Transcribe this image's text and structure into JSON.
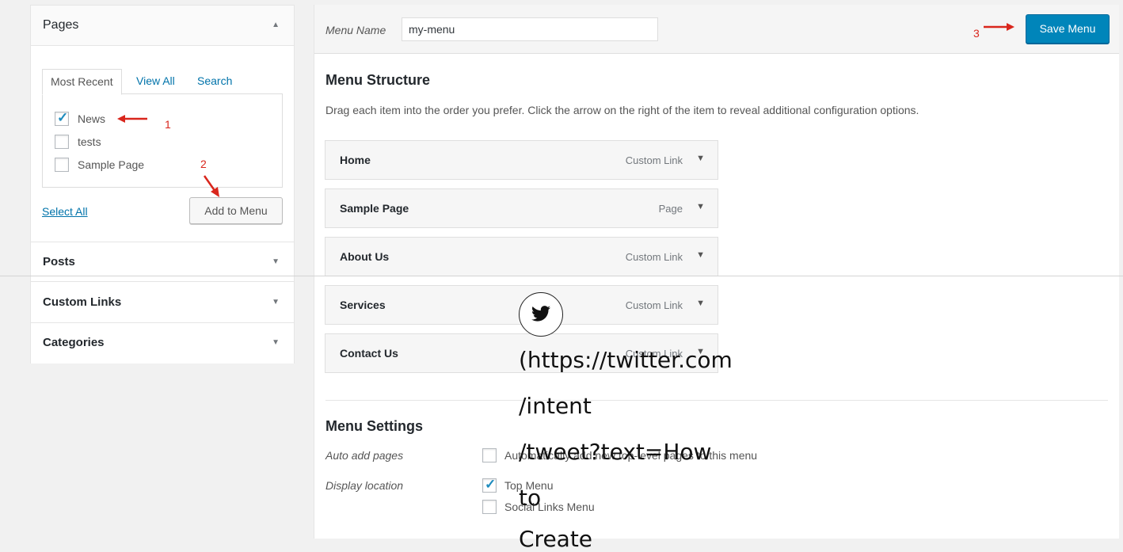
{
  "sidebar": {
    "pages_section": {
      "title": "Pages",
      "arrow": "▲"
    },
    "tabs": {
      "most_recent": "Most Recent",
      "view_all": "View All",
      "search": "Search"
    },
    "pages": [
      {
        "label": "News",
        "checked": true
      },
      {
        "label": "tests",
        "checked": false
      },
      {
        "label": "Sample Page",
        "checked": false
      }
    ],
    "select_all": "Select All",
    "add_to_menu": "Add to Menu",
    "sections": [
      {
        "title": "Posts",
        "arrow": "▼"
      },
      {
        "title": "Custom Links",
        "arrow": "▼"
      },
      {
        "title": "Categories",
        "arrow": "▼"
      }
    ]
  },
  "annotations": {
    "step1": "1",
    "step2": "2",
    "step3": "3",
    "color": "#d9261c"
  },
  "menu": {
    "name_label": "Menu Name",
    "name_value": "my-menu",
    "save_button": "Save Menu",
    "structure_title": "Menu Structure",
    "structure_desc": "Drag each item into the order you prefer. Click the arrow on the right of the item to reveal additional configuration options.",
    "items": [
      {
        "title": "Home",
        "type": "Custom Link"
      },
      {
        "title": "Sample Page",
        "type": "Page"
      },
      {
        "title": "About Us",
        "type": "Custom Link"
      },
      {
        "title": "Services",
        "type": "Custom Link"
      },
      {
        "title": "Contact Us",
        "type": "Custom Link"
      }
    ],
    "item_arrow": "▼"
  },
  "settings": {
    "title": "Menu Settings",
    "auto_add_label": "Auto add pages",
    "auto_add_option": {
      "label": "Automatically add new top-level pages to this menu",
      "checked": false
    },
    "display_location_label": "Display location",
    "locations": [
      {
        "label": "Top Menu",
        "checked": true
      },
      {
        "label": "Social Links Menu",
        "checked": false
      }
    ]
  },
  "overlay": {
    "icon": "twitter-bird-icon",
    "link_lines": [
      "(https://twitter.com",
      "/intent",
      "/tweet?text=How",
      "to",
      "Create"
    ]
  },
  "colors": {
    "primary_button": "#0085ba",
    "link": "#0073aa",
    "checkbox_tick": "#1e8cbe"
  }
}
